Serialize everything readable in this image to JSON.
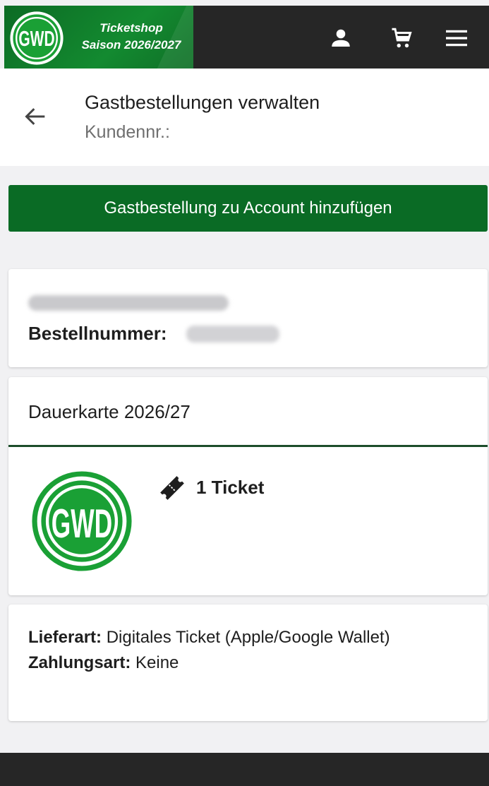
{
  "header": {
    "brand_line1": "Ticketshop",
    "brand_line2": "Saison 2026/2027",
    "icons": [
      "gwd-logo-icon",
      "user-icon",
      "cart-icon",
      "menu-icon"
    ]
  },
  "page": {
    "title": "Gastbestellungen verwalten",
    "subtitle": "Kundennr.:"
  },
  "actions": {
    "add_guest_order_label": "Gastbestellung zu Account hinzufügen"
  },
  "order": {
    "number_label": "Bestellnummer:"
  },
  "event": {
    "name": "Dauerkarte 2026/27",
    "ticket_count": "1 Ticket"
  },
  "delivery": {
    "lieferart_label": "Lieferart:",
    "lieferart_value": "Digitales Ticket (Apple/Google Wallet)",
    "zahlungsart_label": "Zahlungsart:",
    "zahlungsart_value": "Keine"
  },
  "colors": {
    "brand_green": "#0a6b25",
    "header_dark": "#262626",
    "logo_green": "#1aa035"
  }
}
